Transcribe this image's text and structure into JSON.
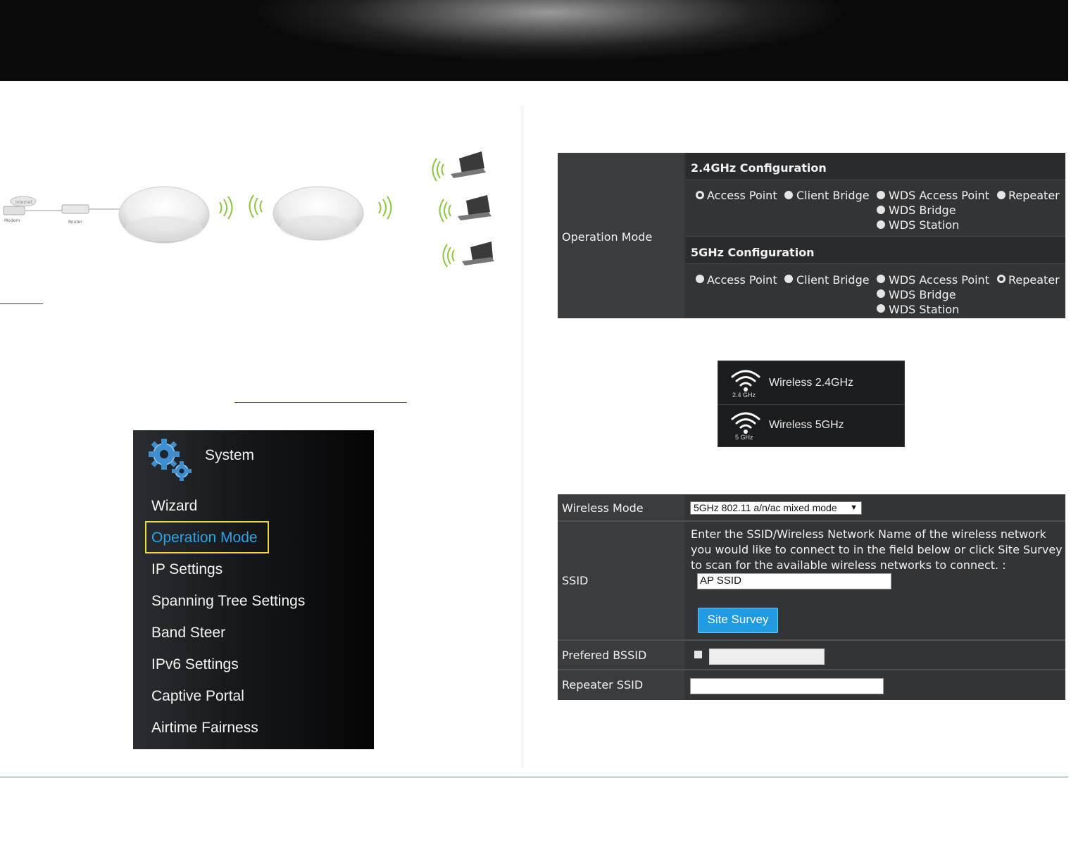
{
  "diagram": {
    "modem_label": "Modem",
    "router_label": "Router",
    "internet_label": "Internet"
  },
  "system_menu": {
    "title": "System",
    "items": [
      {
        "label": "Wizard"
      },
      {
        "label": "Operation Mode",
        "active": true
      },
      {
        "label": "IP Settings"
      },
      {
        "label": "Spanning Tree Settings"
      },
      {
        "label": "Band Steer"
      },
      {
        "label": "IPv6 Settings"
      },
      {
        "label": "Captive Portal"
      },
      {
        "label": "Airtime Fairness"
      }
    ]
  },
  "operation_mode": {
    "label": "Operation Mode",
    "band24": {
      "header": "2.4GHz Configuration",
      "options": [
        "Access Point",
        "Client Bridge",
        "WDS Access Point",
        "Repeater",
        "WDS Bridge",
        "WDS Station"
      ],
      "selected": "Access Point"
    },
    "band5": {
      "header": "5GHz Configuration",
      "options": [
        "Access Point",
        "Client Bridge",
        "WDS Access Point",
        "Repeater",
        "WDS Bridge",
        "WDS Station"
      ],
      "selected": "Repeater"
    }
  },
  "wireless_menu": {
    "items": [
      {
        "label": "Wireless 2.4GHz",
        "band": "2.4 GHz"
      },
      {
        "label": "Wireless 5GHz",
        "band": "5 GHz"
      }
    ]
  },
  "repeater_form": {
    "wireless_mode_label": "Wireless Mode",
    "wireless_mode_value": "5GHz 802.11 a/n/ac mixed mode",
    "ssid_label": "SSID",
    "ssid_help": [
      "Enter the SSID/Wireless Network Name of the wireless network",
      "you would like to connect to in the field below or click Site Survey",
      "to scan for the available wireless networks to connect. :"
    ],
    "ssid_value": "AP SSID",
    "site_survey_label": "Site Survey",
    "preferred_bssid_label": "Prefered BSSID",
    "preferred_bssid_value": "",
    "repeater_ssid_label": "Repeater SSID",
    "repeater_ssid_value": ""
  }
}
